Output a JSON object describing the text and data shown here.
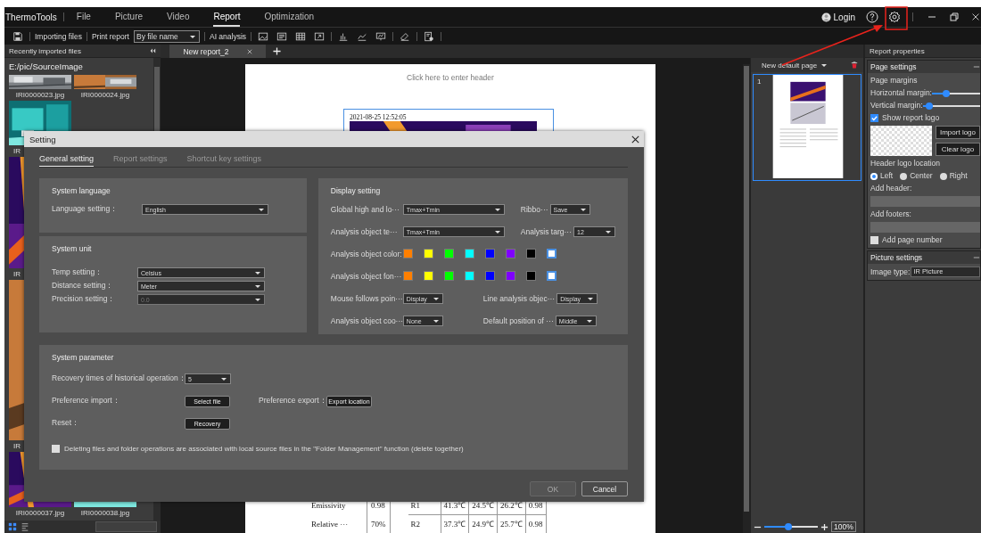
{
  "app": {
    "name": "ThermoTools"
  },
  "menu": [
    {
      "label": "File",
      "selected": false
    },
    {
      "label": "Picture",
      "selected": false
    },
    {
      "label": "Video",
      "selected": false
    },
    {
      "label": "Report",
      "selected": true
    },
    {
      "label": "Optimization",
      "selected": false
    }
  ],
  "login": "Login",
  "toolbar": {
    "import": "Importing files",
    "print": "Print report",
    "sort": "By file name",
    "ai": "AI analysis"
  },
  "sidebar": {
    "title": "Recently imported files",
    "path": "E:/pic/SourceImage",
    "rows": [
      {
        "files": [
          {
            "name": "IRI0000023.jpg",
            "kind": "full"
          },
          {
            "name": "IRI0000024.jpg",
            "kind": "full"
          }
        ]
      },
      {
        "files": [
          {
            "name": "IR",
            "kind": "clipped"
          }
        ]
      },
      {
        "files": [
          {
            "name": "IR",
            "kind": "clipped"
          }
        ]
      },
      {
        "files": [
          {
            "name": "IR",
            "kind": "clipped"
          }
        ]
      },
      {
        "files": [
          {
            "name": "IRI0000037.jpg",
            "kind": "full"
          },
          {
            "name": "IRI0000038.jpg",
            "kind": "full"
          }
        ]
      }
    ]
  },
  "report_tabs": [
    {
      "label": "New report_2",
      "selected": true
    }
  ],
  "report_page": {
    "header_hint": "Click here to enter header",
    "timestamp": "2021-08-25 12:52:05",
    "params": [
      {
        "name": "Emissivity",
        "value": "0.98"
      },
      {
        "name": "Relative ···",
        "value": "70%"
      }
    ],
    "results": [
      {
        "cells": [
          "R1",
          "41.3℃",
          "24.5℃",
          "26.2℃",
          "0.98"
        ]
      },
      {
        "cells": [
          "R2",
          "37.3℃",
          "24.9℃",
          "25.7℃",
          "0.98"
        ]
      }
    ]
  },
  "pages_panel": {
    "new_page": "New default page",
    "pages": [
      {
        "number": "1",
        "selected": true
      }
    ],
    "zoom": {
      "level": 0.45,
      "reading": "100%"
    }
  },
  "properties": {
    "title": "Report properties",
    "page_settings": "Page settings",
    "margins": "Page margins",
    "horizontal": {
      "label": "Horizontal margin:",
      "level": 0.3
    },
    "vertical": {
      "label": "Vertical margin:",
      "level": 0.12
    },
    "show_logo": {
      "label": "Show report logo",
      "checked": true
    },
    "import_logo": "Import logo",
    "clear_logo": "Clear logo",
    "logo_location": "Header logo location",
    "locations": [
      {
        "label": "Left",
        "selected": true
      },
      {
        "label": "Center",
        "selected": false
      },
      {
        "label": "Right",
        "selected": false
      }
    ],
    "add_header": "Add header:",
    "add_footers": "Add footers:",
    "page_number": {
      "label": "Add page number",
      "checked": false
    },
    "picture_settings": "Picture settings",
    "image_type_label": "Image type:",
    "image_type": "IR Picture"
  },
  "dialog": {
    "title": "Setting",
    "tabs": [
      {
        "label": "General setting",
        "selected": true
      },
      {
        "label": "Report settings",
        "selected": false
      },
      {
        "label": "Shortcut key settings",
        "selected": false
      }
    ],
    "language": {
      "title": "System language",
      "fields": [
        {
          "label": "Language setting：",
          "value": "English",
          "disabled": false
        }
      ]
    },
    "unit": {
      "title": "System unit",
      "fields": [
        {
          "label": "Temp setting：",
          "value": "Celsius",
          "disabled": false
        },
        {
          "label": "Distance setting：",
          "value": "Meter",
          "disabled": false
        },
        {
          "label": "Precision setting：",
          "value": "0.0",
          "disabled": true
        }
      ]
    },
    "display": {
      "title": "Display setting",
      "rows": [
        {
          "kind": "wide",
          "items": [
            {
              "label": "Global high and lo···",
              "value": "Tmax+Tmin"
            },
            {
              "label": "Ribbo···",
              "value": "Save"
            }
          ]
        },
        {
          "kind": "wide",
          "items": [
            {
              "label": "Analysis object te···",
              "value": "Tmax+Tmin"
            },
            {
              "label": "Analysis targ···",
              "value": "12"
            }
          ]
        },
        {
          "kind": "colors",
          "label": "Analysis object color:",
          "swatches": [
            {
              "color": "#ff7f00",
              "selected": false
            },
            {
              "color": "#ffff00",
              "selected": false
            },
            {
              "color": "#00ff00",
              "selected": false
            },
            {
              "color": "#00ffff",
              "selected": false
            },
            {
              "color": "#0000ff",
              "selected": false
            },
            {
              "color": "#7f00ff",
              "selected": false
            },
            {
              "color": "#000000",
              "selected": false
            },
            {
              "color": "#ffffff",
              "selected": true
            }
          ]
        },
        {
          "kind": "colors",
          "label": "Analysis object fon···",
          "swatches": [
            {
              "color": "#ff7f00",
              "selected": false
            },
            {
              "color": "#ffff00",
              "selected": false
            },
            {
              "color": "#00ff00",
              "selected": false
            },
            {
              "color": "#00ffff",
              "selected": false
            },
            {
              "color": "#0000ff",
              "selected": false
            },
            {
              "color": "#7f00ff",
              "selected": false
            },
            {
              "color": "#000000",
              "selected": false
            },
            {
              "color": "#ffffff",
              "selected": true
            }
          ]
        },
        {
          "kind": "narrow",
          "items": [
            {
              "label": "Mouse follows poin···",
              "value": "Display"
            },
            {
              "label": "Line analysis objec···",
              "value": "Display"
            }
          ]
        },
        {
          "kind": "narrow",
          "items": [
            {
              "label": "Analysis object coo···",
              "value": "None"
            },
            {
              "label": "Default position of ···",
              "value": "Middle"
            }
          ]
        }
      ]
    },
    "params": {
      "title": "System parameter",
      "recovery": {
        "label": "Recovery times of historical operation：",
        "value": "5"
      },
      "import": {
        "label": "Preference import：",
        "button": "Select file"
      },
      "export": {
        "label": "Preference export：",
        "button": "Export location"
      },
      "reset": {
        "label": "Reset：",
        "button": "Recovery"
      },
      "link_delete": {
        "label": "Deleting files and folder operations are associated with local source files in the \"Folder Management\" function (delete together)",
        "checked": false
      }
    },
    "buttons": [
      {
        "label": "OK",
        "disabled": true
      },
      {
        "label": "Cancel",
        "disabled": false
      }
    ]
  }
}
